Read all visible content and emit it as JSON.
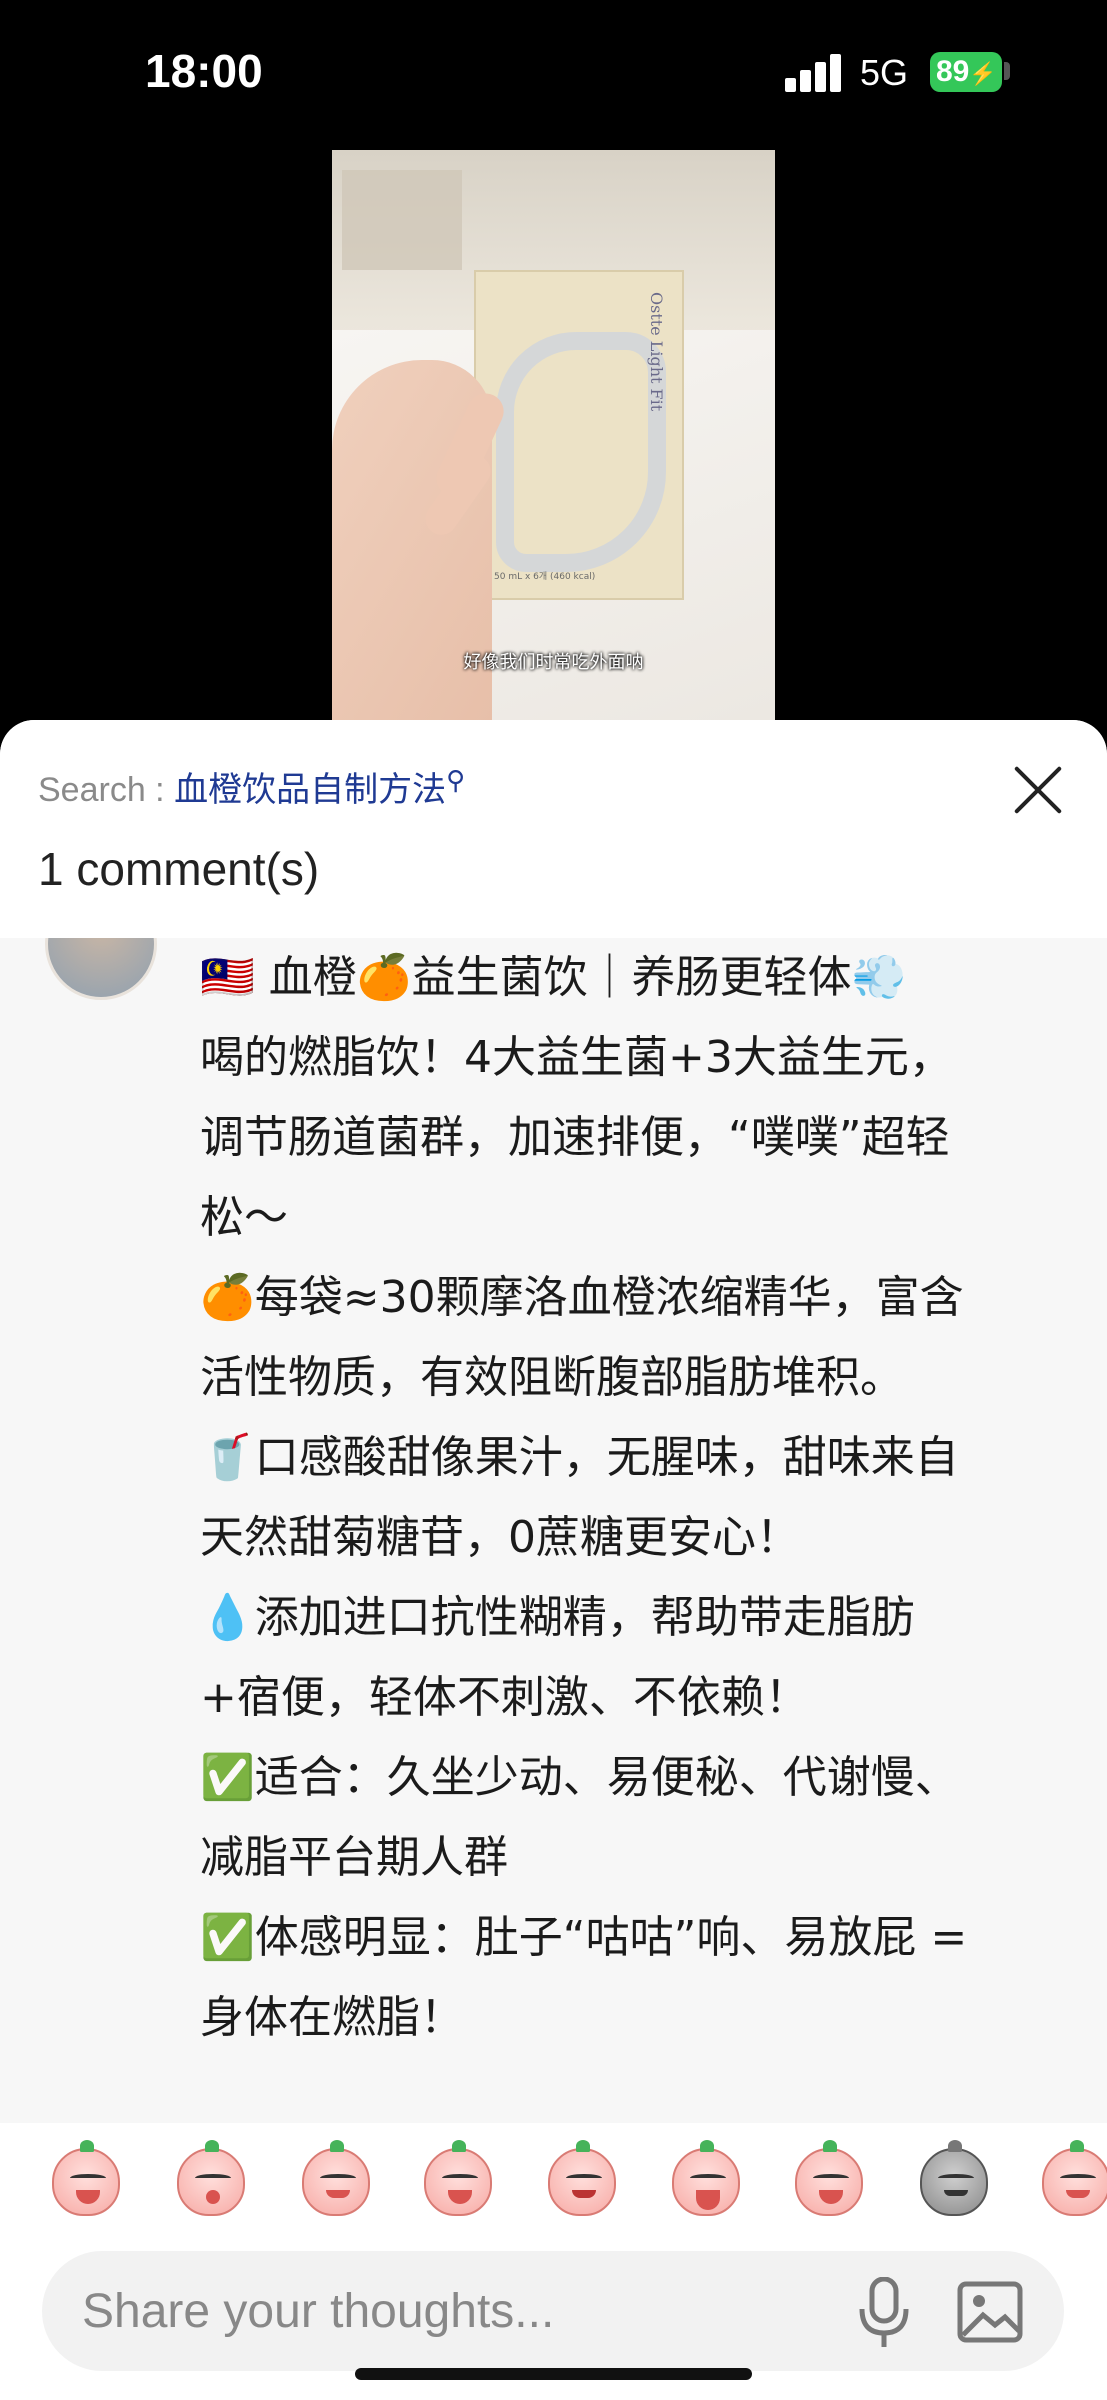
{
  "status_bar": {
    "time": "18:00",
    "network": "5G",
    "battery": "89"
  },
  "video": {
    "caption": "好像我们时常吃外面呐",
    "product_name": "Ostte Light Fit",
    "product_detail": "50 mL x 6개 (460 kcal)"
  },
  "header": {
    "search_label": "Search : ",
    "search_query": "血橙饮品自制方法",
    "search_icon": "search-icon",
    "comment_count": "1 comment(s)"
  },
  "comment": {
    "lines": [
      "🇲🇾 血橙🍊益生菌饮｜养肠更轻体💨",
      "喝的燃脂饮！4大益生菌+3大益生元，",
      "调节肠道菌群，加速排便，“噗噗”超轻",
      "松～",
      "🍊每袋≈30颗摩洛血橙浓缩精华，富含",
      "活性物质，有效阻断腹部脂肪堆积。",
      "🥤口感酸甜像果汁，无腥味，甜味来自",
      "天然甜菊糖苷，0蔗糖更安心！",
      "💧添加进口抗性糊精，帮助带走脂肪",
      "+宿便，轻体不刺激、不依赖！",
      "✅适合：久坐少动、易便秘、代谢慢、",
      "减脂平台期人群",
      "✅体感明显：肚子“咕咕”响、易放屁 =",
      "身体在燃脂！"
    ]
  },
  "emoji_bar": {
    "items": [
      "crying-peach-emoji",
      "kissing-peach-emoji",
      "shy-peach-emoji",
      "facepalm-peach-emoji",
      "praying-peach-emoji",
      "laughing-peach-emoji",
      "sobbing-peach-emoji",
      "gray-peach-emoji",
      "smiling-peach-emoji"
    ]
  },
  "input": {
    "placeholder": "Share your thoughts..."
  }
}
